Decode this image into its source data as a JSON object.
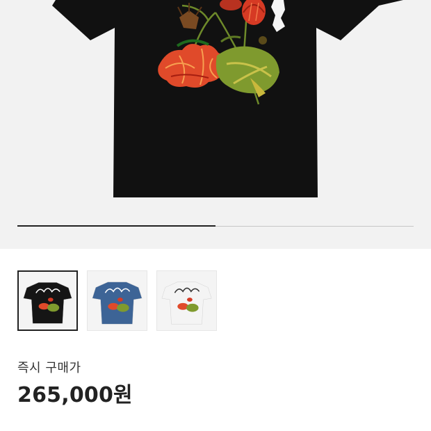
{
  "gallery": {
    "main_image": "black-tshirt-floral-print",
    "progress": 0.5
  },
  "thumbnails": [
    {
      "name": "black-tshirt-thumbnail",
      "color": "#151515",
      "print": "stussy-floral",
      "selected": true
    },
    {
      "name": "blue-tshirt-thumbnail",
      "color": "#3d6496",
      "print": "stussy-floral",
      "selected": false
    },
    {
      "name": "white-tshirt-thumbnail",
      "color": "#f4f4f4",
      "print": "stussy-floral",
      "selected": false
    }
  ],
  "price": {
    "label": "즉시 구매가",
    "value": "265,000원"
  },
  "colors": {
    "tshirt_black": "#111111",
    "petal_red": "#e04a2a",
    "leaf_green": "#7f9a2e",
    "gallery_bg": "#f2f2f2"
  }
}
